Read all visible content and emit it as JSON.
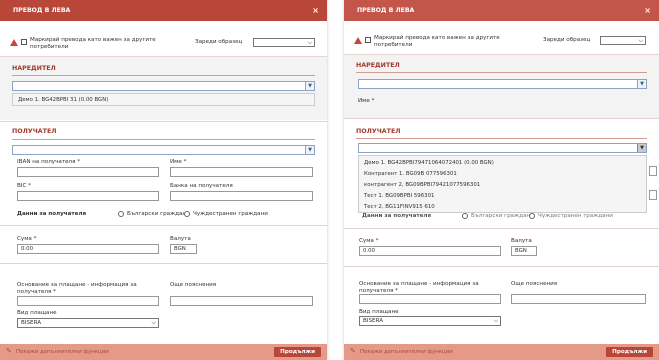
{
  "dialog": {
    "title": "ПРЕВОД В ЛЕВА",
    "close": "×",
    "mark_important": "Маркирай превода като важен за другите потребители",
    "load_template": "Зареди образец",
    "orderer_section": "НАРЕДИТЕЛ",
    "recipient_section": "ПОЛУЧАТЕЛ",
    "iban_label": "IBAN на получателя *",
    "name_label": "Име *",
    "bic_label": "BIC *",
    "bank_label": "Банка на получателя",
    "recipient_data": "Данни за получателя",
    "bulgarian": "Български граждани",
    "foreign": "Чуждестранен граждани",
    "amount_label": "Сума *",
    "amount_value": "0.00",
    "currency_label": "Валута",
    "currency_value": "BGN",
    "reason_label": "Основание за плащане - информация за получателя *",
    "more_info_label": "Още пояснения",
    "payment_type_label": "Вид плащане",
    "payment_type_value": "BISERA",
    "show_more": "Покажи допълнителни функции",
    "continue": "Продължи",
    "left_account_option": "Демо 1. BG42BPBI                      31 (0.00 BGN)",
    "recipient_options": [
      "Демо 1. BG42BPBI79471064072401 (0.00 BGN)",
      "Контрагент 1. BG09B              077596301",
      "контрагент 2, BG09BPBI79421077596301",
      "Тест 1. BG09BPBI              596301",
      "Тест 2, BG11FINV915              610"
    ]
  }
}
